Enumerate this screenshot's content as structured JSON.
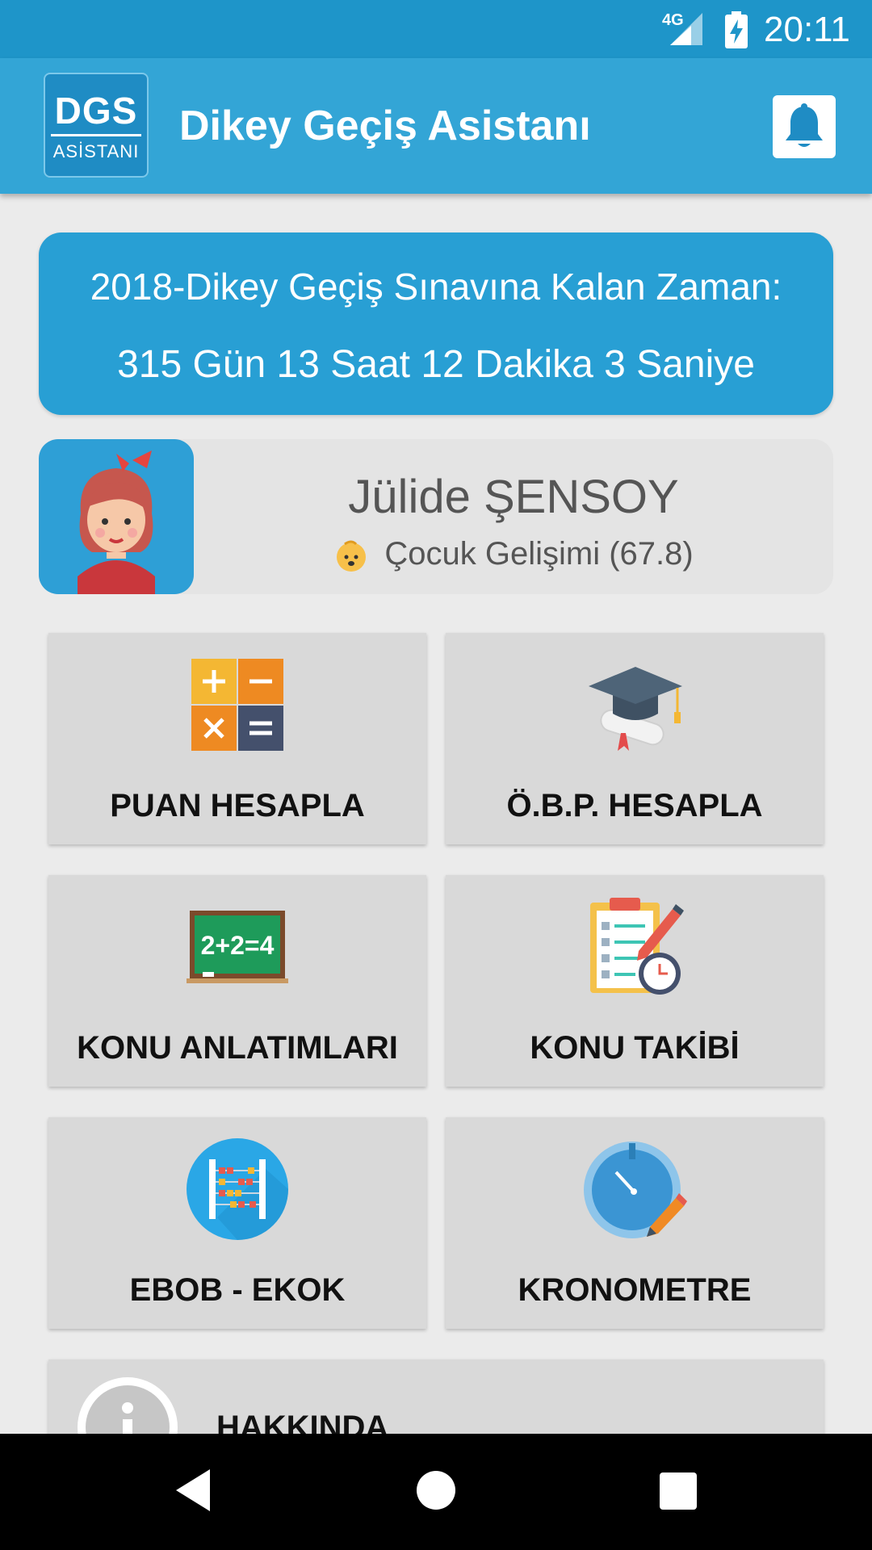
{
  "status_bar": {
    "network": "4G",
    "time": "20:11",
    "icons": [
      "signal-icon",
      "battery-charging-icon"
    ]
  },
  "app_bar": {
    "logo_text_top": "DGS",
    "logo_text_bottom": "ASİSTANI",
    "title": "Dikey Geçiş Asistanı",
    "notification_icon": "bell-icon"
  },
  "countdown": {
    "line1": "2018-Dikey Geçiş Sınavına Kalan Zaman:",
    "line2": "315 Gün 13 Saat 12 Dakika 3 Saniye"
  },
  "profile": {
    "name": "Jülide ŞENSOY",
    "department": "Çocuk Gelişimi (67.8)",
    "avatar_icon": "woman-avatar-icon",
    "department_icon": "baby-icon"
  },
  "tiles": [
    {
      "label": "PUAN HESAPLA",
      "icon": "calculator-icon"
    },
    {
      "label": "Ö.B.P. HESAPLA",
      "icon": "graduation-cap-icon"
    },
    {
      "label": "KONU ANLATIMLARI",
      "icon": "chalkboard-icon"
    },
    {
      "label": "KONU TAKİBİ",
      "icon": "checklist-clock-icon"
    },
    {
      "label": "EBOB - EKOK",
      "icon": "abacus-icon"
    },
    {
      "label": "KRONOMETRE",
      "icon": "stopwatch-icon"
    }
  ],
  "about": {
    "label": "HAKKINDA",
    "icon": "info-icon"
  },
  "nav_bar": {
    "icons": [
      "back-icon",
      "home-icon",
      "recents-icon"
    ]
  },
  "colors": {
    "status_bar": "#1e95c9",
    "app_bar": "#33a5d6",
    "countdown_bg": "#289fd4",
    "tile_bg": "#d9d9d9",
    "page_bg": "#ebebeb"
  }
}
